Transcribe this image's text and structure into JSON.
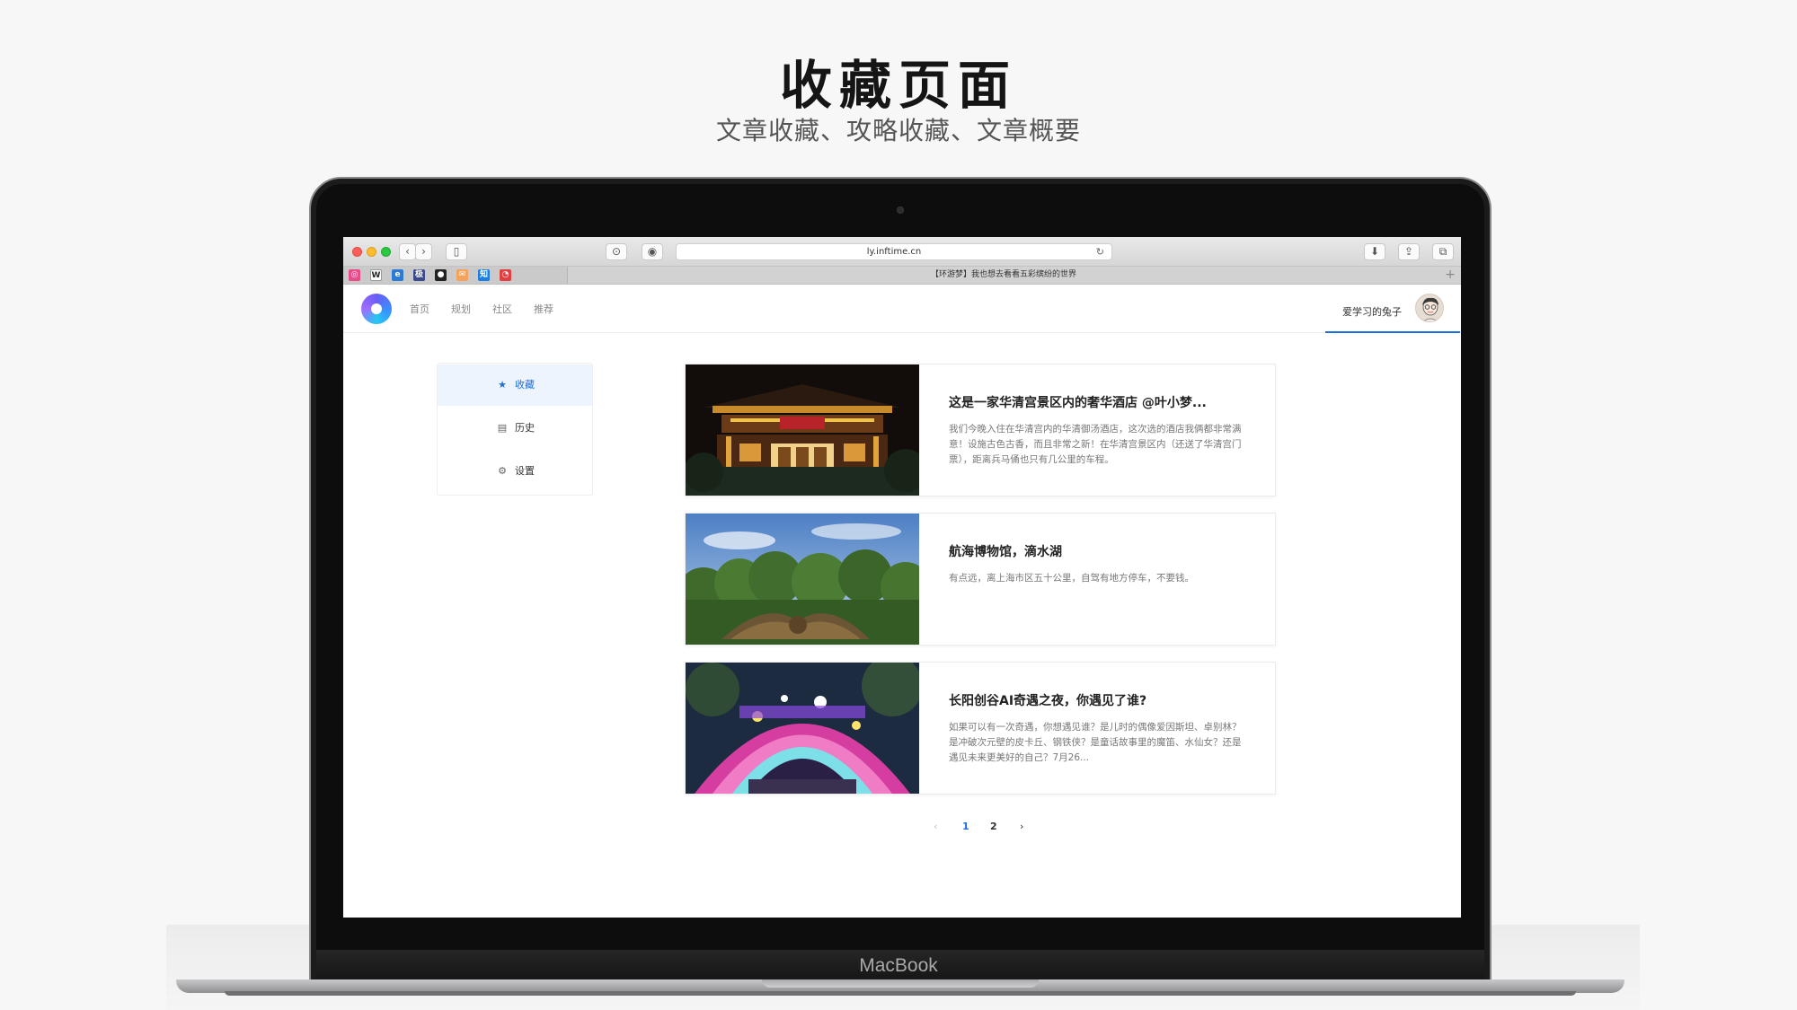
{
  "hero": {
    "title": "收藏页面",
    "subtitle": "文章收藏、攻略收藏、文章概要"
  },
  "laptop": {
    "brand": "MacBook"
  },
  "browser": {
    "url": "ly.inftime.cn",
    "tab_title": "【环游梦】我也想去看看五彩缤纷的世界",
    "favorites": [
      {
        "name": "dribbble-icon",
        "glyph": "◎",
        "color": "#ea4c89"
      },
      {
        "name": "wikipedia-icon",
        "glyph": "W",
        "color": "#ffffff"
      },
      {
        "name": "edge-icon",
        "glyph": "e",
        "color": "#2b7bd6"
      },
      {
        "name": "bookmark-icon",
        "glyph": "极",
        "color": "#3b4a8a"
      },
      {
        "name": "github-icon",
        "glyph": "●",
        "color": "#222222"
      },
      {
        "name": "mail-icon",
        "glyph": "✉",
        "color": "#f3a35b"
      },
      {
        "name": "zhihu-icon",
        "glyph": "知",
        "color": "#1d7de0"
      },
      {
        "name": "search-app-icon",
        "glyph": "◔",
        "color": "#e04040"
      }
    ]
  },
  "header": {
    "nav": [
      "首页",
      "规划",
      "社区",
      "推荐"
    ],
    "user_name": "爱学习的兔子"
  },
  "sidebar": {
    "items": [
      {
        "label": "收藏",
        "icon": "star-icon",
        "glyph": "★",
        "active": true
      },
      {
        "label": "历史",
        "icon": "clipboard-icon",
        "glyph": "▤",
        "active": false
      },
      {
        "label": "设置",
        "icon": "gear-icon",
        "glyph": "⚙",
        "active": false
      }
    ]
  },
  "articles": [
    {
      "title": "这是一家华清宫景区内的奢华酒店 @叶小梦...",
      "desc": "我们今晚入住在华清宫内的华清御汤酒店，这次选的酒店我俩都非常满意！设施古色古香，而且非常之新！在华清宫景区内（还送了华清宫门票），距离兵马俑也只有几公里的车程。"
    },
    {
      "title": "航海博物馆，滴水湖",
      "desc": "有点远，离上海市区五十公里，自驾有地方停车，不要钱。"
    },
    {
      "title": "长阳创谷AI奇遇之夜，你遇见了谁?",
      "desc": "如果可以有一次奇遇，你想遇见谁？是儿时的偶像爱因斯坦、卓别林？是冲破次元壁的皮卡丘、钢铁侠？是童话故事里的魔笛、水仙女？还是遇见未来更美好的自己？7月26..."
    }
  ],
  "pagination": {
    "prev": "‹",
    "pages": [
      "1",
      "2"
    ],
    "current": "1",
    "next": "›"
  },
  "colors": {
    "accent": "#1d6fd8",
    "active_bg": "#eef4fd"
  }
}
